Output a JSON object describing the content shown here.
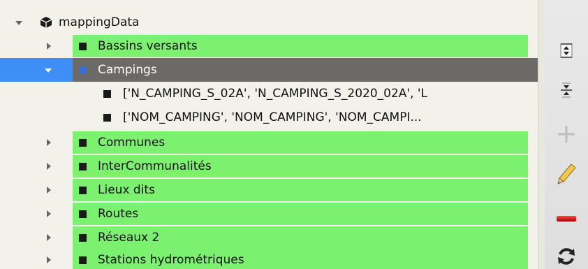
{
  "tree": {
    "root": {
      "label": "mappingData",
      "icon": "package-icon",
      "expanded": true
    },
    "layers": [
      {
        "label": "Bassins versants",
        "expanded": false,
        "selected": false
      },
      {
        "label": "Campings",
        "expanded": true,
        "selected": true,
        "children": [
          "['N_CAMPING_S_02A', 'N_CAMPING_S_2020_02A', 'L",
          "['NOM_CAMPING', 'NOM_CAMPING', 'NOM_CAMPI..."
        ]
      },
      {
        "label": "Communes",
        "expanded": false,
        "selected": false
      },
      {
        "label": "InterCommunalités",
        "expanded": false,
        "selected": false
      },
      {
        "label": "Lieux dits",
        "expanded": false,
        "selected": false
      },
      {
        "label": "Routes",
        "expanded": false,
        "selected": false
      },
      {
        "label": "Réseaux 2",
        "expanded": false,
        "selected": false
      },
      {
        "label": "Stations hydrométriques",
        "expanded": false,
        "selected": false
      }
    ]
  },
  "toolbar": {
    "buttons": [
      {
        "name": "expand-all-icon"
      },
      {
        "name": "collapse-all-icon"
      },
      {
        "name": "add-icon"
      },
      {
        "name": "edit-pencil-icon"
      },
      {
        "name": "remove-icon"
      },
      {
        "name": "refresh-icon"
      }
    ]
  },
  "colors": {
    "row_highlight": "#7cf06f",
    "selection_dark": "#6b6a67",
    "selection_blue": "#3f8ef6",
    "tree_background": "#f3f2ea"
  }
}
